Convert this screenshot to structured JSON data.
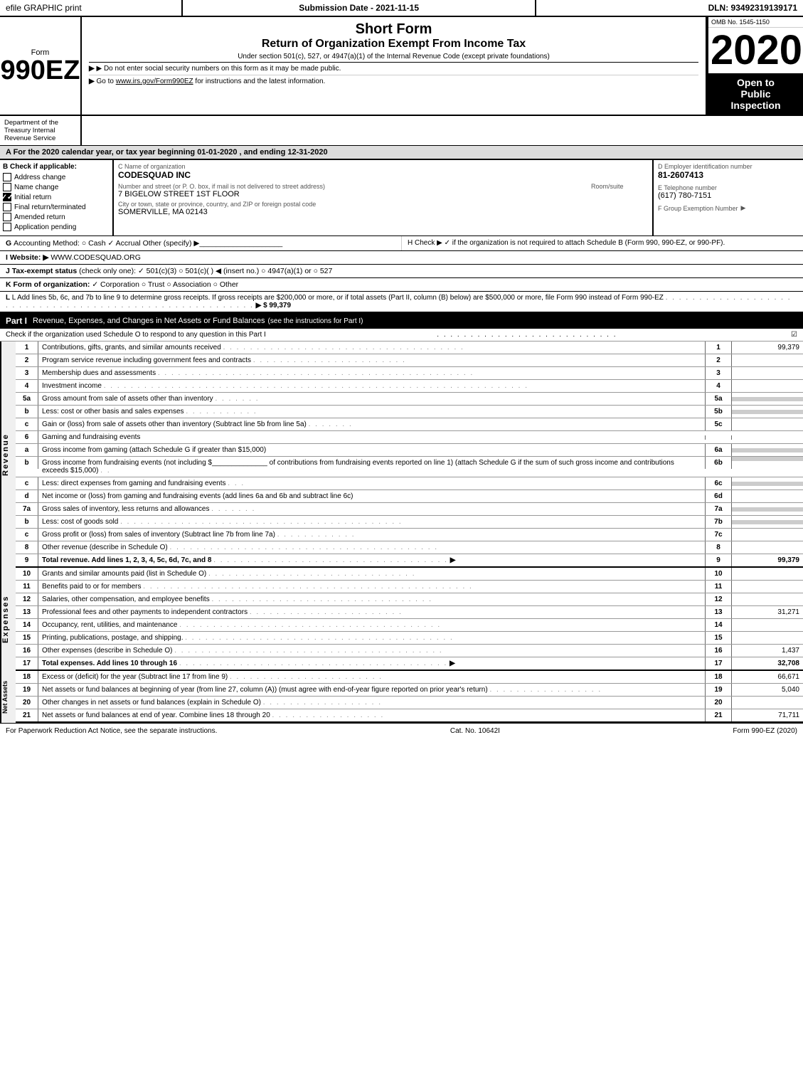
{
  "topbar": {
    "left": "efile GRAPHIC print",
    "mid": "Submission Date - 2021-11-15",
    "right": "DLN: 93492319139171"
  },
  "form": {
    "label": "Form",
    "number": "990EZ",
    "short_form": "Short Form",
    "return_title": "Return of Organization Exempt From Income Tax",
    "under_section": "Under section 501(c), 527, or 4947(a)(1) of the Internal Revenue Code (except private foundations)",
    "year": "2020",
    "omb": "OMB No. 1545-1150",
    "open_to_public": "Open to",
    "public_label": "Public",
    "inspection_label": "Inspection"
  },
  "dept": {
    "name": "Department of the Treasury Internal Revenue Service",
    "notice1": "▶ Do not enter social security numbers on this form as it may be made public.",
    "notice2_prefix": "▶ Go to ",
    "notice2_link": "www.irs.gov/Form990EZ",
    "notice2_suffix": " for instructions and the latest information."
  },
  "taxyear": {
    "text": "A For the 2020 calendar year, or tax year beginning 01-01-2020 , and ending 12-31-2020"
  },
  "section_b": {
    "label": "B Check if applicable:",
    "checkboxes": [
      {
        "label": "Address change",
        "checked": false
      },
      {
        "label": "Name change",
        "checked": false
      },
      {
        "label": "Initial return",
        "checked": true
      },
      {
        "label": "Final return/terminated",
        "checked": false
      },
      {
        "label": "Amended return",
        "checked": false
      },
      {
        "label": "Application pending",
        "checked": false
      }
    ]
  },
  "org": {
    "c_label": "C Name of organization",
    "name": "CODESQUAD INC",
    "address_label": "Number and street (or P. O. box, if mail is not delivered to street address)",
    "address": "7 BIGELOW STREET 1ST FLOOR",
    "room_label": "Room/suite",
    "room": "",
    "city_label": "City or town, state or province, country, and ZIP or foreign postal code",
    "city": "SOMERVILLE, MA  02143"
  },
  "ein": {
    "d_label": "D Employer identification number",
    "ein_value": "81-2607413",
    "e_label": "E Telephone number",
    "phone": "(617) 780-7151",
    "f_label": "F Group Exemption Number",
    "f_value": ""
  },
  "section_g": {
    "label": "G",
    "text": "Accounting Method:",
    "cash": "Cash",
    "accrual": "Accrual",
    "other": "Other (specify) ▶"
  },
  "section_h": {
    "text": "H  Check ▶  ✓  if the organization is not required to attach Schedule B (Form 990, 990-EZ, or 990-PF)."
  },
  "website": {
    "label": "I Website: ▶",
    "url": "WWW.CODESQUAD.ORG"
  },
  "tax_exempt": {
    "label": "J Tax-exempt status",
    "text": "(check only one):  ✓ 501(c)(3)  ○ 501(c)(   )  ◀ (insert no.)  ○ 4947(a)(1) or  ○ 527"
  },
  "form_org": {
    "label": "K Form of organization:",
    "text": "✓ Corporation   ○ Trust   ○ Association   ○ Other"
  },
  "line_l": {
    "text": "L Add lines 5b, 6c, and 7b to line 9 to determine gross receipts. If gross receipts are $200,000 or more, or if total assets (Part II, column (B) below) are $500,000 or more, file Form 990 instead of Form 990-EZ",
    "dots": ". . . . . . . . . . . . . . . . . . . . . . . . . . . . . . . . . . . . . . . . . . . . . . . . . . . . . . . . . . . . . .",
    "value": "▶ $ 99,379"
  },
  "part1": {
    "header": "Part I",
    "title": "Revenue, Expenses, and Changes in Net Assets or Fund Balances",
    "subtitle": "(see the instructions for Part I)",
    "check_text": "Check if the organization used Schedule O to respond to any question in this Part I",
    "check_dots": ". . . . . . . . . . . . . . . . . . . . . . . . . . ."
  },
  "revenue_rows": [
    {
      "num": "1",
      "desc": "Contributions, gifts, grants, and similar amounts received",
      "dots": true,
      "col_num": "1",
      "value": "99,379"
    },
    {
      "num": "2",
      "desc": "Program service revenue including government fees and contracts",
      "dots": true,
      "col_num": "2",
      "value": ""
    },
    {
      "num": "3",
      "desc": "Membership dues and assessments",
      "dots": true,
      "col_num": "3",
      "value": ""
    },
    {
      "num": "4",
      "desc": "Investment income",
      "dots": true,
      "col_num": "4",
      "value": ""
    },
    {
      "num": "5a",
      "desc": "Gross amount from sale of assets other than inventory",
      "dots_short": true,
      "col_num": "5a",
      "value": "",
      "shaded": true
    },
    {
      "num": "5b",
      "sub": true,
      "desc": "Less: cost or other basis and sales expenses",
      "dots_short": true,
      "col_num": "5b",
      "value": "",
      "shaded": true
    },
    {
      "num": "5c",
      "sub": true,
      "desc": "Gain or (loss) from sale of assets other than inventory (Subtract line 5b from line 5a)",
      "dots": true,
      "col_num": "5c",
      "value": ""
    },
    {
      "num": "6",
      "desc": "Gaming and fundraising events",
      "col_num": "",
      "value": "",
      "header": true
    },
    {
      "num": "6a",
      "sub": true,
      "desc": "Gross income from gaming (attach Schedule G if greater than $15,000)",
      "col_num": "6a",
      "value": "",
      "shaded": true
    },
    {
      "num": "6b",
      "sub": true,
      "desc": "Gross income from fundraising events (not including $______ of contributions from fundraising events reported on line 1) (attach Schedule G if the sum of such gross income and contributions exceeds $15,000)",
      "col_num": "6b",
      "value": "",
      "shaded": true
    },
    {
      "num": "6c",
      "sub": true,
      "desc": "Less: direct expenses from gaming and fundraising events",
      "col_num": "6c",
      "value": "",
      "shaded": true
    },
    {
      "num": "6d",
      "sub": true,
      "desc": "Net income or (loss) from gaming and fundraising events (add lines 6a and 6b and subtract line 6c)",
      "col_num": "6d",
      "value": ""
    },
    {
      "num": "7a",
      "desc": "Gross sales of inventory, less returns and allowances",
      "col_num": "7a",
      "value": "",
      "shaded": true
    },
    {
      "num": "7b",
      "sub": true,
      "desc": "Less: cost of goods sold",
      "col_num": "7b",
      "value": "",
      "shaded": true
    },
    {
      "num": "7c",
      "sub": true,
      "desc": "Gross profit or (loss) from sales of inventory (Subtract line 7b from line 7a)",
      "dots": true,
      "col_num": "7c",
      "value": ""
    },
    {
      "num": "8",
      "desc": "Other revenue (describe in Schedule O)",
      "dots": true,
      "col_num": "8",
      "value": ""
    },
    {
      "num": "9",
      "desc": "Total revenue. Add lines 1, 2, 3, 4, 5c, 6d, 7c, and 8",
      "dots": true,
      "col_num": "9",
      "value": "99,379",
      "bold": true,
      "arrow": true
    }
  ],
  "expense_rows": [
    {
      "num": "10",
      "desc": "Grants and similar amounts paid (list in Schedule O)",
      "dots": true,
      "col_num": "10",
      "value": ""
    },
    {
      "num": "11",
      "desc": "Benefits paid to or for members",
      "dots": true,
      "col_num": "11",
      "value": ""
    },
    {
      "num": "12",
      "desc": "Salaries, other compensation, and employee benefits",
      "dots": true,
      "col_num": "12",
      "value": ""
    },
    {
      "num": "13",
      "desc": "Professional fees and other payments to independent contractors",
      "dots": true,
      "col_num": "13",
      "value": "31,271"
    },
    {
      "num": "14",
      "desc": "Occupancy, rent, utilities, and maintenance",
      "dots": true,
      "col_num": "14",
      "value": ""
    },
    {
      "num": "15",
      "desc": "Printing, publications, postage, and shipping.",
      "dots": true,
      "col_num": "15",
      "value": ""
    },
    {
      "num": "16",
      "desc": "Other expenses (describe in Schedule O)",
      "dots": true,
      "col_num": "16",
      "value": "1,437"
    },
    {
      "num": "17",
      "desc": "Total expenses. Add lines 10 through 16",
      "dots": true,
      "col_num": "17",
      "value": "32,708",
      "bold": true,
      "arrow": true
    }
  ],
  "net_asset_rows": [
    {
      "num": "18",
      "desc": "Excess or (deficit) for the year (Subtract line 17 from line 9)",
      "dots": true,
      "col_num": "18",
      "value": "66,671"
    },
    {
      "num": "19",
      "desc": "Net assets or fund balances at beginning of year (from line 27, column (A)) (must agree with end-of-year figure reported on prior year's return)",
      "dots": true,
      "col_num": "19",
      "value": "5,040"
    },
    {
      "num": "20",
      "desc": "Other changes in net assets or fund balances (explain in Schedule O)",
      "dots": true,
      "col_num": "20",
      "value": ""
    },
    {
      "num": "21",
      "desc": "Net assets or fund balances at end of year. Combine lines 18 through 20",
      "dots": true,
      "col_num": "21",
      "value": "71,711"
    }
  ],
  "footer": {
    "left": "For Paperwork Reduction Act Notice, see the separate instructions.",
    "mid": "Cat. No. 10642I",
    "right": "Form 990-EZ (2020)"
  }
}
